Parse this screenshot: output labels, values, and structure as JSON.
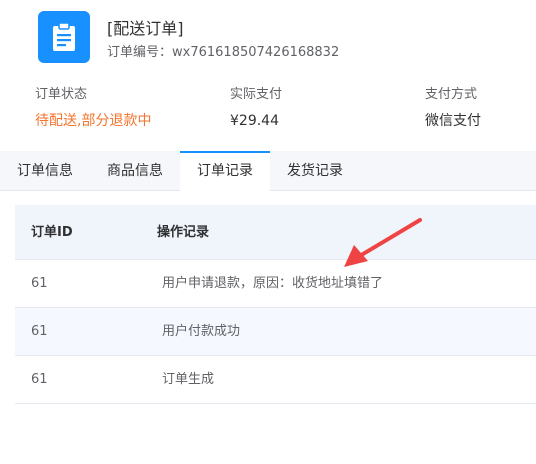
{
  "header": {
    "icon": "clipboard-icon",
    "title": "[配送订单]",
    "order_no_label": "订单编号：",
    "order_no": "wx761618507426168832"
  },
  "summary": {
    "status_label": "订单状态",
    "status_value": "待配送,部分退款中",
    "paid_label": "实际支付",
    "paid_value": "¥29.44",
    "method_label": "支付方式",
    "method_value": "微信支付"
  },
  "tabs": [
    {
      "label": "订单信息",
      "active": false
    },
    {
      "label": "商品信息",
      "active": false
    },
    {
      "label": "订单记录",
      "active": true
    },
    {
      "label": "发货记录",
      "active": false
    }
  ],
  "table": {
    "columns": [
      "订单ID",
      "操作记录"
    ],
    "rows": [
      {
        "id": "61",
        "record": "用户申请退款，原因：收货地址填错了"
      },
      {
        "id": "61",
        "record": "用户付款成功"
      },
      {
        "id": "61",
        "record": "订单生成"
      }
    ]
  },
  "colors": {
    "accent": "#1890ff",
    "status_warn": "#f5732c",
    "annotation_arrow": "#ee4444"
  }
}
